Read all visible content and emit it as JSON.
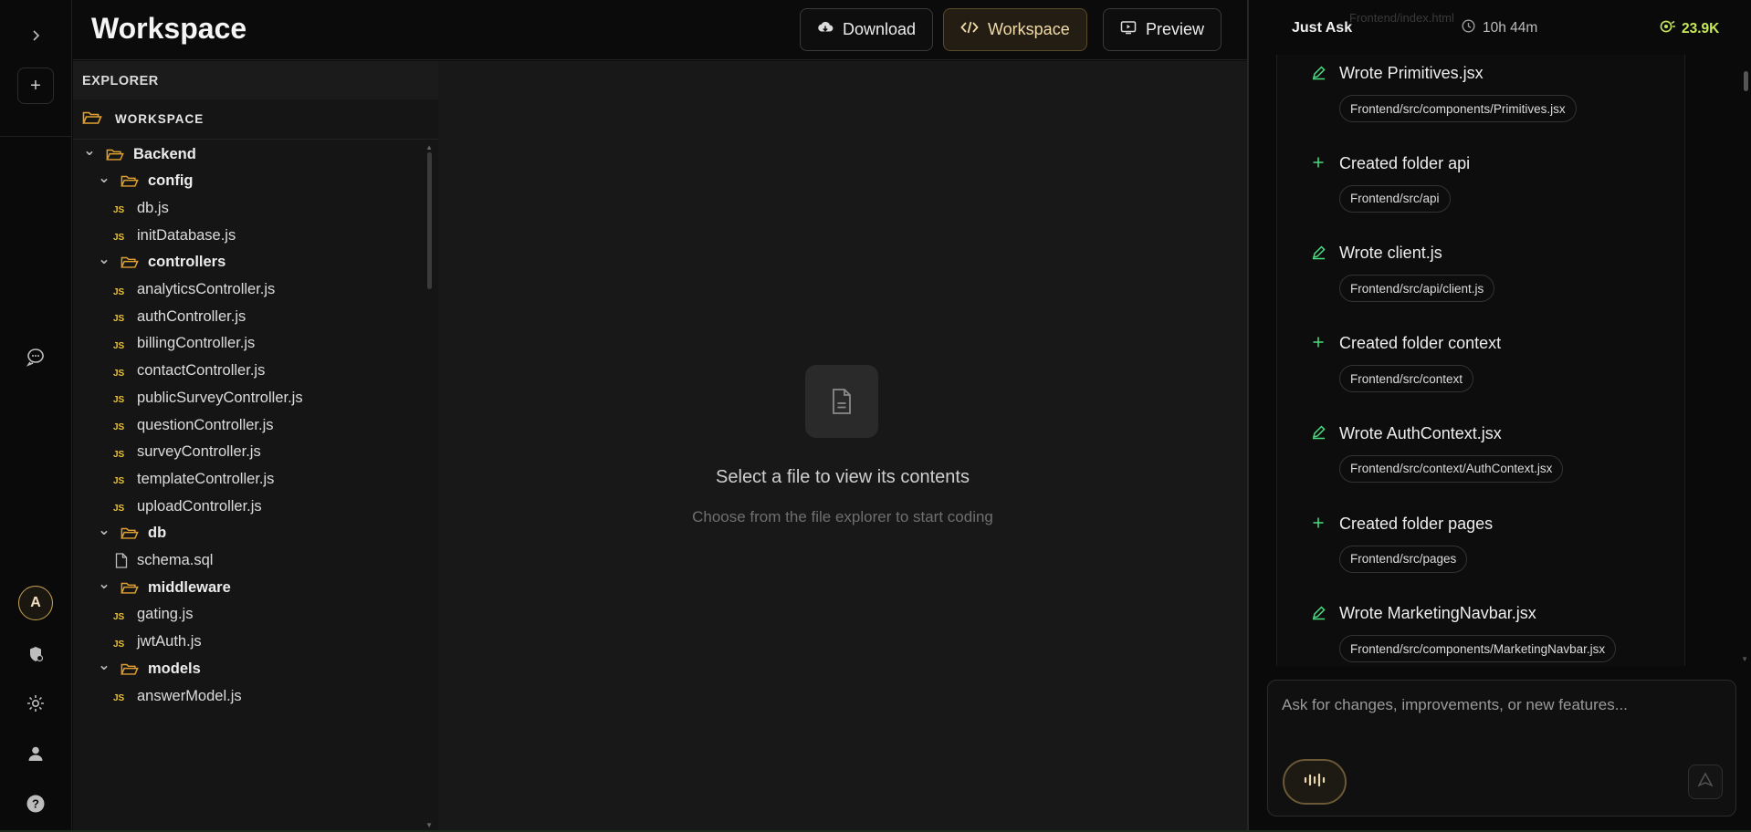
{
  "header": {
    "title": "Workspace",
    "buttons": {
      "download": "Download",
      "workspace": "Workspace",
      "preview": "Preview"
    }
  },
  "rail": {
    "avatar_letter": "A",
    "icons": [
      "chevron-right-icon",
      "plus-icon",
      "chat-icon",
      "shield-icon",
      "gear-icon",
      "user-icon",
      "help-icon"
    ]
  },
  "explorer": {
    "heading": "EXPLORER",
    "workspace_label": "WORKSPACE",
    "tree": [
      {
        "type": "folder",
        "depth": 0,
        "name": "Backend"
      },
      {
        "type": "folder",
        "depth": 1,
        "name": "config"
      },
      {
        "type": "js",
        "depth": 2,
        "name": "db.js"
      },
      {
        "type": "js",
        "depth": 2,
        "name": "initDatabase.js"
      },
      {
        "type": "folder",
        "depth": 1,
        "name": "controllers"
      },
      {
        "type": "js",
        "depth": 2,
        "name": "analyticsController.js"
      },
      {
        "type": "js",
        "depth": 2,
        "name": "authController.js"
      },
      {
        "type": "js",
        "depth": 2,
        "name": "billingController.js"
      },
      {
        "type": "js",
        "depth": 2,
        "name": "contactController.js"
      },
      {
        "type": "js",
        "depth": 2,
        "name": "publicSurveyController.js"
      },
      {
        "type": "js",
        "depth": 2,
        "name": "questionController.js"
      },
      {
        "type": "js",
        "depth": 2,
        "name": "surveyController.js"
      },
      {
        "type": "js",
        "depth": 2,
        "name": "templateController.js"
      },
      {
        "type": "js",
        "depth": 2,
        "name": "uploadController.js"
      },
      {
        "type": "folder",
        "depth": 1,
        "name": "db"
      },
      {
        "type": "file",
        "depth": 2,
        "name": "schema.sql"
      },
      {
        "type": "folder",
        "depth": 1,
        "name": "middleware"
      },
      {
        "type": "js",
        "depth": 2,
        "name": "gating.js"
      },
      {
        "type": "js",
        "depth": 2,
        "name": "jwtAuth.js"
      },
      {
        "type": "folder",
        "depth": 1,
        "name": "models"
      },
      {
        "type": "js",
        "depth": 2,
        "name": "answerModel.js"
      }
    ],
    "js_badge": "JS"
  },
  "editor": {
    "empty_title": "Select a file to view its contents",
    "empty_subtitle": "Choose from the file explorer to start coding"
  },
  "chat": {
    "label": "Just Ask",
    "ghost_path": "Frontend/index.html",
    "timer": "10h 44m",
    "tokens": "23.9K",
    "steps": [
      {
        "kind": "write",
        "label": "Wrote Primitives.jsx",
        "path": "Frontend/src/components/Primitives.jsx"
      },
      {
        "kind": "folder",
        "label": "Created folder api",
        "path": "Frontend/src/api"
      },
      {
        "kind": "write",
        "label": "Wrote client.js",
        "path": "Frontend/src/api/client.js"
      },
      {
        "kind": "folder",
        "label": "Created folder context",
        "path": "Frontend/src/context"
      },
      {
        "kind": "write",
        "label": "Wrote AuthContext.jsx",
        "path": "Frontend/src/context/AuthContext.jsx"
      },
      {
        "kind": "folder",
        "label": "Created folder pages",
        "path": "Frontend/src/pages"
      },
      {
        "kind": "write",
        "label": "Wrote MarketingNavbar.jsx",
        "path": "Frontend/src/components/MarketingNavbar.jsx"
      }
    ],
    "input_placeholder": "Ask for changes, improvements, or new features..."
  },
  "colors": {
    "accent_gold": "#c9a053",
    "accent_green": "#4ade80",
    "tokens_green": "#c7e85a",
    "js_yellow": "#e8c23a",
    "folder_orange": "#e0a030"
  }
}
